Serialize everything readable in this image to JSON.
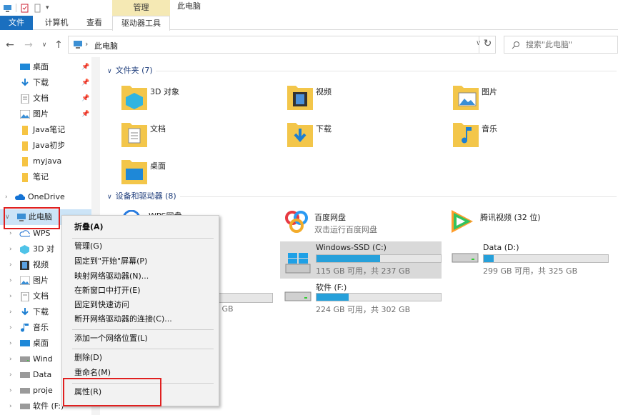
{
  "ribbon": {
    "context_tab": "管理",
    "window_title": "此电脑",
    "tabs": {
      "file": "文件",
      "computer": "计算机",
      "view": "查看",
      "drive_tools": "驱动器工具"
    }
  },
  "address": {
    "path": "此电脑",
    "search_placeholder": "搜索\"此电脑\""
  },
  "nav": {
    "quick_access": [
      {
        "label": "桌面",
        "icon": "desktop-icon",
        "pinned": true
      },
      {
        "label": "下载",
        "icon": "download-icon",
        "pinned": true
      },
      {
        "label": "文档",
        "icon": "document-icon",
        "pinned": true
      },
      {
        "label": "图片",
        "icon": "picture-icon",
        "pinned": true
      },
      {
        "label": "Java笔记",
        "icon": "folder-icon"
      },
      {
        "label": "Java初步",
        "icon": "folder-icon"
      },
      {
        "label": "myjava",
        "icon": "folder-icon"
      },
      {
        "label": "笔记",
        "icon": "folder-icon"
      }
    ],
    "onedrive": "OneDrive",
    "this_pc": "此电脑",
    "this_pc_children": [
      {
        "label": "WPS",
        "icon": "cloud-icon"
      },
      {
        "label": "3D 对",
        "icon": "3d-objects-icon"
      },
      {
        "label": "视频",
        "icon": "video-icon"
      },
      {
        "label": "图片",
        "icon": "picture-icon"
      },
      {
        "label": "文档",
        "icon": "document-icon"
      },
      {
        "label": "下载",
        "icon": "download-icon"
      },
      {
        "label": "音乐",
        "icon": "music-icon"
      },
      {
        "label": "桌面",
        "icon": "desktop-icon"
      },
      {
        "label": "Wind",
        "icon": "drive-icon"
      },
      {
        "label": "Data",
        "icon": "drive-icon"
      },
      {
        "label": "proje",
        "icon": "drive-icon"
      },
      {
        "label": "软件 (F:)",
        "icon": "drive-icon"
      }
    ]
  },
  "folders_group": {
    "header": "文件夹 (7)",
    "items": [
      {
        "label": "3D 对象",
        "icon": "3d-objects-icon"
      },
      {
        "label": "视频",
        "icon": "video-icon"
      },
      {
        "label": "图片",
        "icon": "picture-icon"
      },
      {
        "label": "文档",
        "icon": "document-icon"
      },
      {
        "label": "下载",
        "icon": "download-icon"
      },
      {
        "label": "音乐",
        "icon": "music-icon"
      },
      {
        "label": "桌面",
        "icon": "desktop-icon"
      }
    ]
  },
  "devices_group": {
    "header": "设备和驱动器 (8)",
    "wps_partial": "WPS网盘",
    "baidu": {
      "name": "百度网盘",
      "desc": "双击运行百度网盘"
    },
    "tencent": {
      "name": "腾讯视频 (32 位)"
    },
    "drives": [
      {
        "name": "Windows-SSD (C:)",
        "free": "115 GB 可用，共 237 GB",
        "used_fraction": 0.51,
        "selected": true
      },
      {
        "name": "Data (D:)",
        "free": "299 GB 可用，共 325 GB",
        "used_fraction": 0.08
      },
      {
        "name": "软件 (F:)",
        "free": "224 GB 可用，共 302 GB",
        "used_fraction": 0.26
      }
    ],
    "hidden_drive_free_partial": "3 GB"
  },
  "context_menu": {
    "items": [
      "折叠(A)",
      "管理(G)",
      "固定到\"开始\"屏幕(P)",
      "映射网络驱动器(N)...",
      "在新窗口中打开(E)",
      "固定到快速访问",
      "断开网络驱动器的连接(C)...",
      "添加一个网络位置(L)",
      "删除(D)",
      "重命名(M)",
      "属性(R)"
    ]
  },
  "colors": {
    "accent": "#1a6fbf",
    "context_tab": "#f5e9b4",
    "drive_bar": "#26a0da",
    "highlight_box": "#e02020",
    "group_header": "#1e3d7b"
  }
}
